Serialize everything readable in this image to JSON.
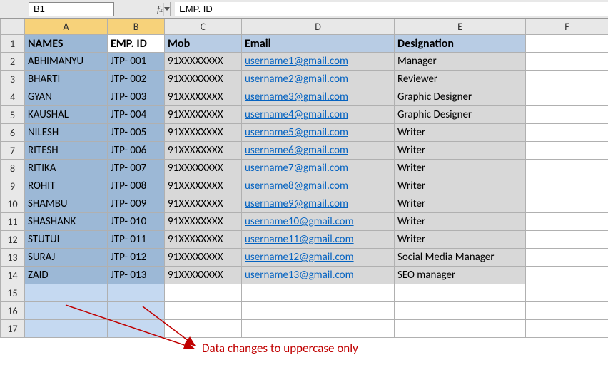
{
  "namebox": {
    "value": "B1"
  },
  "formula_bar": {
    "value": "EMP. ID"
  },
  "headers": {
    "A": "NAMES",
    "B": "EMP. ID",
    "C": "Mob",
    "D": "Email",
    "E": "Designation"
  },
  "col_letters": [
    "A",
    "B",
    "C",
    "D",
    "E",
    "F"
  ],
  "rows": [
    {
      "name": "ABHIMANYU",
      "emp": "JTP- 001",
      "mob": "91XXXXXXXX",
      "email": "username1@gmail.com",
      "desig": "Manager"
    },
    {
      "name": "BHARTI",
      "emp": "JTP- 002",
      "mob": "91XXXXXXXX",
      "email": "username2@gmail.com",
      "desig": "Reviewer"
    },
    {
      "name": "GYAN",
      "emp": "JTP- 003",
      "mob": "91XXXXXXXX",
      "email": "username3@gmail.com",
      "desig": "Graphic Designer"
    },
    {
      "name": "KAUSHAL",
      "emp": "JTP- 004",
      "mob": "91XXXXXXXX",
      "email": "username4@gmail.com",
      "desig": "Graphic Designer"
    },
    {
      "name": "NILESH",
      "emp": "JTP- 005",
      "mob": "91XXXXXXXX",
      "email": "username5@gmail.com",
      "desig": "Writer"
    },
    {
      "name": "RITESH",
      "emp": "JTP- 006",
      "mob": "91XXXXXXXX",
      "email": "username6@gmail.com",
      "desig": "Writer"
    },
    {
      "name": "RITIKA",
      "emp": "JTP- 007",
      "mob": "91XXXXXXXX",
      "email": "username7@gmail.com",
      "desig": "Writer"
    },
    {
      "name": "ROHIT",
      "emp": "JTP- 008",
      "mob": "91XXXXXXXX",
      "email": "username8@gmail.com",
      "desig": "Writer"
    },
    {
      "name": "SHAMBU",
      "emp": "JTP- 009",
      "mob": "91XXXXXXXX",
      "email": "username9@gmail.com",
      "desig": "Writer"
    },
    {
      "name": "SHASHANK",
      "emp": "JTP- 010",
      "mob": "91XXXXXXXX",
      "email": "username10@gmail.com",
      "desig": "Writer"
    },
    {
      "name": "STUTUI",
      "emp": "JTP- 011",
      "mob": "91XXXXXXXX",
      "email": "username11@gmail.com",
      "desig": "Writer"
    },
    {
      "name": "SURAJ",
      "emp": "JTP- 012",
      "mob": "91XXXXXXXX",
      "email": "username12@gmail.com",
      "desig": "Social Media Manager"
    },
    {
      "name": "ZAID",
      "emp": "JTP- 013",
      "mob": "91XXXXXXXX",
      "email": "username13@gmail.com",
      "desig": "SEO manager"
    }
  ],
  "empty_rows_visible": 3,
  "annotation": {
    "text": "Data changes to uppercase only",
    "color": "#c00000"
  }
}
